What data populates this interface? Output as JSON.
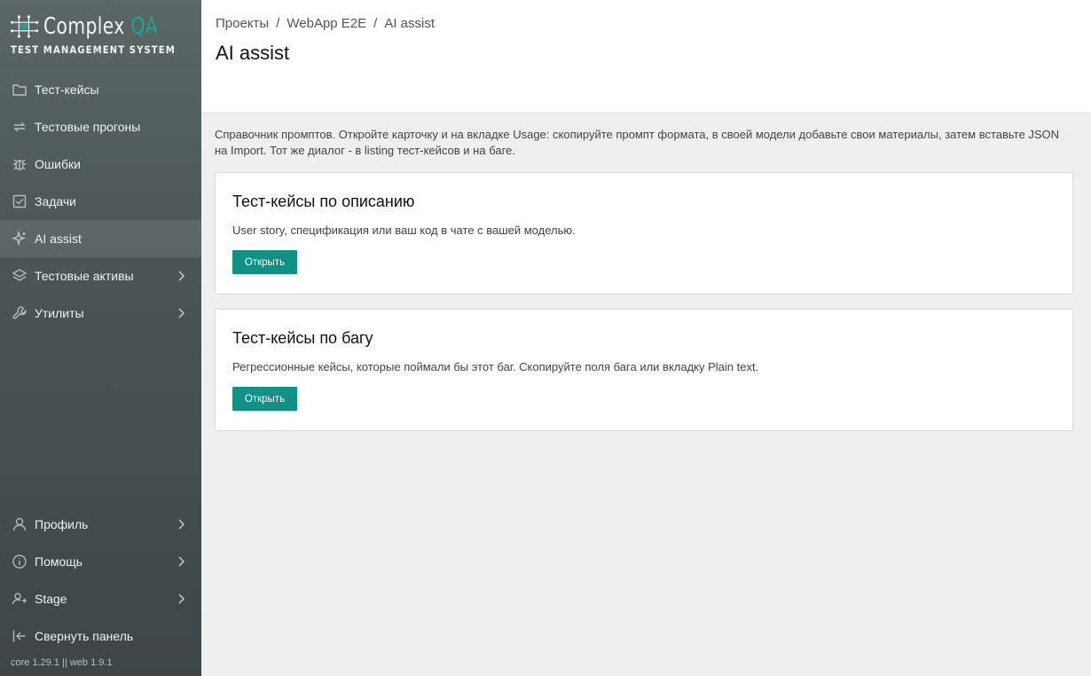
{
  "app": {
    "logo_name": "Complex ",
    "logo_name_accent": "QA",
    "logo_subtitle": "TEST MANAGEMENT SYSTEM",
    "version": "core 1.29.1 || web 1.9.1"
  },
  "sidebar": {
    "items": [
      {
        "label": "Тест-кейсы",
        "icon": "folder-icon"
      },
      {
        "label": "Тестовые прогоны",
        "icon": "repeat-icon"
      },
      {
        "label": "Ошибки",
        "icon": "bug-icon"
      },
      {
        "label": "Задачи",
        "icon": "checkbox-icon"
      },
      {
        "label": "AI assist",
        "icon": "sparkle-icon",
        "active": true
      },
      {
        "label": "Тестовые активы",
        "icon": "layers-icon",
        "expandable": true
      },
      {
        "label": "Утилиты",
        "icon": "wrench-icon",
        "expandable": true
      }
    ],
    "bottom_items": [
      {
        "label": "Профиль",
        "icon": "user-icon",
        "expandable": true
      },
      {
        "label": "Помощь",
        "icon": "info-icon",
        "expandable": true
      },
      {
        "label": "Stage",
        "icon": "user-switch-icon",
        "expandable": true
      },
      {
        "label": "Свернуть панель",
        "icon": "collapse-icon"
      }
    ]
  },
  "header": {
    "breadcrumb": [
      "Проекты",
      "WebApp E2E",
      "AI assist"
    ],
    "breadcrumb_separator": "/",
    "title": "AI assist"
  },
  "main": {
    "intro": "Справочник промптов. Откройте карточку и на вкладке Usage: скопируйте промпт формата, в своей модели добавьте свои материалы, затем вставьте JSON на Import. Тот же диалог - в listing тест-кейсов и на баге.",
    "cards": [
      {
        "title": "Тест-кейсы по описанию",
        "description": "User story, спецификация или ваш код в чате с вашей моделью.",
        "button": "Открыть"
      },
      {
        "title": "Тест-кейсы по багу",
        "description": "Регрессионные кейсы, которые поймали бы этот баг. Скопируйте поля бага или вкладку Plain text.",
        "button": "Открыть"
      }
    ]
  },
  "colors": {
    "accent": "#0f9184",
    "sidebar_top": "#5a6766",
    "sidebar_bottom": "#3d4645"
  }
}
